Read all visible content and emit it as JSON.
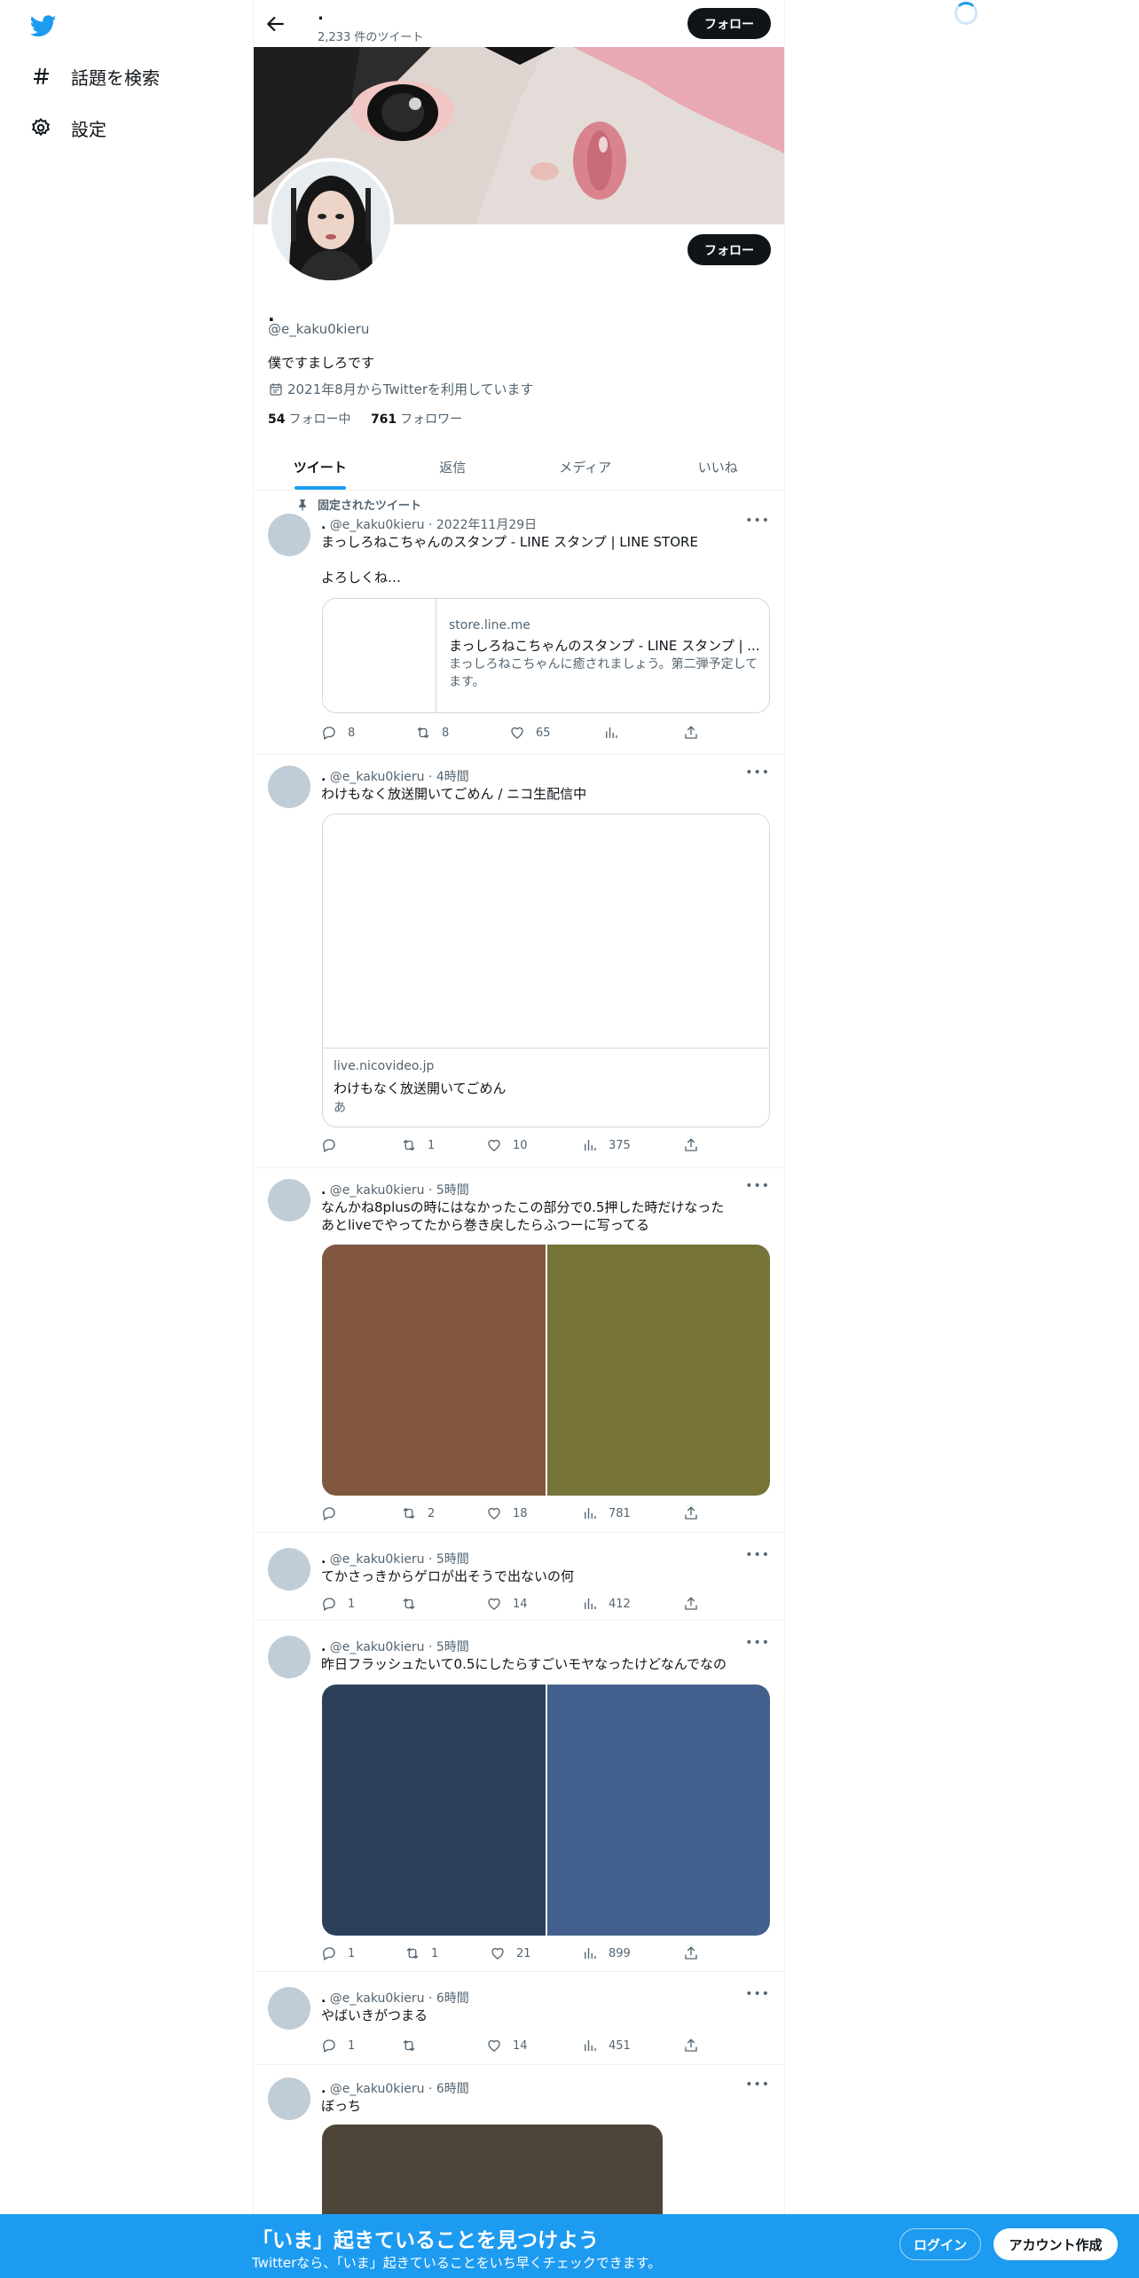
{
  "nav": {
    "explore_label": "話題を検索",
    "settings_label": "設定"
  },
  "header": {
    "name": ".",
    "tweet_count": "2,233 件のツイート",
    "follow_label": "フォロー"
  },
  "profile": {
    "name": ".",
    "handle": "@e_kaku0kieru",
    "bio": "僕ですましろです",
    "joined": "2021年8月からTwitterを利用しています",
    "following_count": "54",
    "following_label": "フォロー中",
    "followers_count": "761",
    "followers_label": "フォロワー",
    "follow_label": "フォロー"
  },
  "tabs": [
    "ツイート",
    "返信",
    "メディア",
    "いいね"
  ],
  "pinned_label": "固定されたツイート",
  "tweets": [
    {
      "name": ".",
      "handle": "@e_kaku0kieru",
      "time": "2022年11月29日",
      "text": "まっしろねこちゃんのスタンプ - LINE スタンプ | LINE STORE\n\nよろしくね…",
      "card": {
        "domain": "store.line.me",
        "title": "まっしろねこちゃんのスタンプ - LINE スタンプ | ...",
        "desc": "まっしろねこちゃんに癒されましょう。第二弾予定してます。"
      },
      "replies": "8",
      "retweets": "8",
      "likes": "65",
      "views": ""
    },
    {
      "name": ".",
      "handle": "@e_kaku0kieru",
      "time": "4時間",
      "text": "わけもなく放送開いてごめん / ニコ生配信中",
      "card": {
        "domain": "live.nicovideo.jp",
        "title": "わけもなく放送開いてごめん",
        "desc": "あ"
      },
      "replies": "",
      "retweets": "1",
      "likes": "10",
      "views": "375"
    },
    {
      "name": ".",
      "handle": "@e_kaku0kieru",
      "time": "5時間",
      "text": "なんかね8plusの時にはなかったこの部分で0.5押した時だけなった\nあとliveでやってたから巻き戻したらふつーに写ってる",
      "media_colors": [
        "#82573f",
        "#767439"
      ],
      "replies": "",
      "retweets": "2",
      "likes": "18",
      "views": "781"
    },
    {
      "name": ".",
      "handle": "@e_kaku0kieru",
      "time": "5時間",
      "text": "てかさっきからゲロが出そうで出ないの何",
      "replies": "1",
      "retweets": "",
      "likes": "14",
      "views": "412"
    },
    {
      "name": ".",
      "handle": "@e_kaku0kieru",
      "time": "5時間",
      "text": "昨日フラッシュたいて0.5にしたらすごいモヤなったけどなんでなの",
      "media_colors": [
        "#2b3f5a",
        "#425f8d"
      ],
      "replies": "1",
      "retweets": "1",
      "likes": "21",
      "views": "899"
    },
    {
      "name": ".",
      "handle": "@e_kaku0kieru",
      "time": "6時間",
      "text": "やばいきがつまる",
      "replies": "1",
      "retweets": "",
      "likes": "14",
      "views": "451"
    },
    {
      "name": ".",
      "handle": "@e_kaku0kieru",
      "time": "6時間",
      "text": "ぼっち",
      "media_colors": [
        "#4d4537"
      ]
    }
  ],
  "bottom_bar": {
    "title": "「いま」起きていることを見つけよう",
    "subtitle": "Twitterなら、「いま」起きていることをいち早くチェックできます。",
    "login_label": "ログイン",
    "signup_label": "アカウント作成"
  },
  "colors": {
    "accent": "#1d9bf0",
    "text": "#0f1419",
    "muted": "#536471"
  }
}
